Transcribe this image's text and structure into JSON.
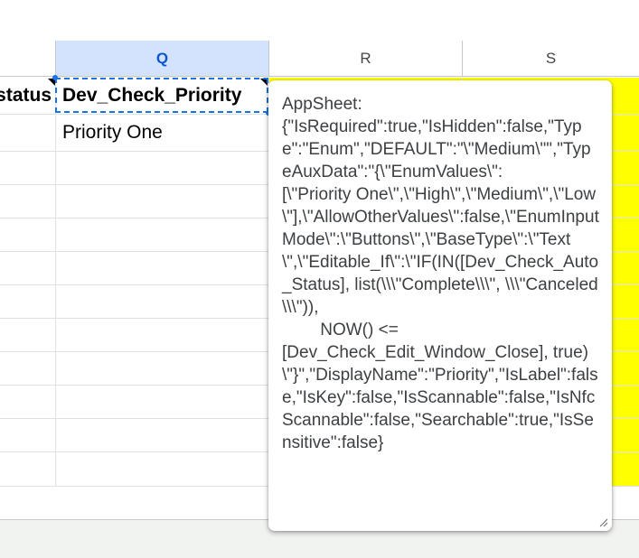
{
  "columns": {
    "q": "Q",
    "r": "R",
    "s": "S"
  },
  "header_row": {
    "prev_cell_text": "status",
    "q_cell_text": "Dev_Check_Priority"
  },
  "rows": [
    {
      "q": "Priority One"
    },
    {
      "q": ""
    },
    {
      "q": ""
    },
    {
      "q": ""
    },
    {
      "q": ""
    },
    {
      "q": ""
    },
    {
      "q": ""
    },
    {
      "q": ""
    },
    {
      "q": ""
    },
    {
      "q": ""
    },
    {
      "q": ""
    }
  ],
  "note": {
    "text": "AppSheet:\n{\"IsRequired\":true,\"IsHidden\":false,\"Type\":\"Enum\",\"DEFAULT\":\"\\\"Medium\\\"\",\"TypeAuxData\":\"{\\\"EnumValues\\\":\n[\\\"Priority One\\\",\\\"High\\\",\\\"Medium\\\",\\\"Low\\\"],\\\"AllowOtherValues\\\":false,\\\"EnumInputMode\\\":\\\"Buttons\\\",\\\"BaseType\\\":\\\"Text\\\",\\\"Editable_If\\\":\\\"IF(IN([Dev_Check_Auto_Status], list(\\\\\\\"Complete\\\\\\\", \\\\\\\"Canceled\\\\\\\")),\n        NOW() <=\n[Dev_Check_Edit_Window_Close], true)\\\"}\",\"DisplayName\":\"Priority\",\"IsLabel\":false,\"IsKey\":false,\"IsScannable\":false,\"IsNfcScannable\":false,\"Searchable\":true,\"IsSensitive\":false}"
  },
  "colors": {
    "selected_header_bg": "#d3e3fd",
    "selection_border": "#1a73e8",
    "highlight_yellow": "#ffff00"
  }
}
